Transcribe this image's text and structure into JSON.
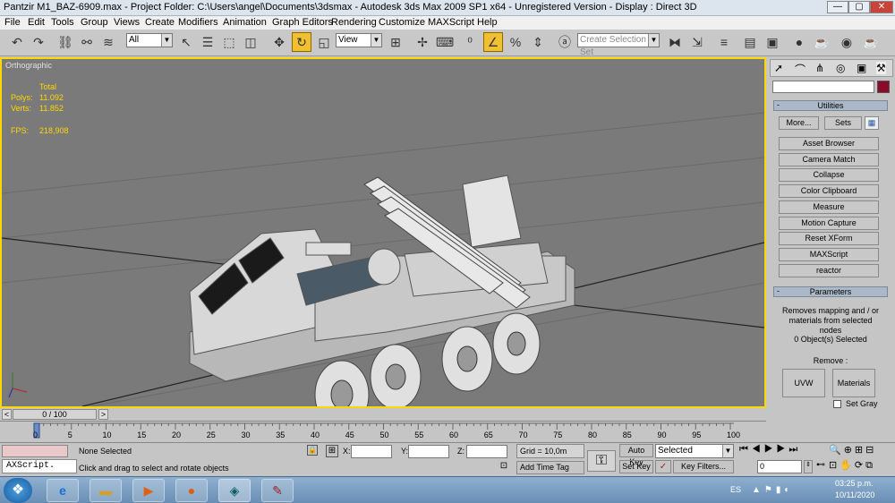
{
  "window": {
    "title": "Pantzir M1_BAZ-6909.max    - Project Folder: C:\\Users\\angel\\Documents\\3dsmax    - Autodesk 3ds Max  2009 SP1  x64   - Unregistered Version    - Display : Direct 3D",
    "minimize": "—",
    "maximize": "▢",
    "close": "✕"
  },
  "menubar": {
    "items": [
      "File",
      "Edit",
      "Tools",
      "Group",
      "Views",
      "Create",
      "Modifiers",
      "Animation",
      "Graph Editors",
      "Rendering",
      "Customize",
      "MAXScript",
      "Help"
    ]
  },
  "toolbar": {
    "filter_select": "All",
    "view_select": "View",
    "selection_set": "Create Selection Set"
  },
  "viewport": {
    "label": "Orthographic",
    "stats_header": "Total",
    "polys_label": "Polys:",
    "polys_value": "11.092",
    "verts_label": "Verts:",
    "verts_value": "11.852",
    "fps_label": "FPS:",
    "fps_value": "218,908",
    "bg_color": "#7a7a7a",
    "border_color": "#ffd700",
    "stats_color": "#ffd700"
  },
  "command_panel": {
    "name_field": "",
    "utilities_header": "Utilities",
    "more_button": "More...",
    "sets_button": "Sets",
    "utility_buttons": [
      "Asset Browser",
      "Camera Match",
      "Collapse",
      "Color Clipboard",
      "Measure",
      "Motion Capture",
      "Reset XForm",
      "MAXScript",
      "reactor"
    ],
    "parameters_header": "Parameters",
    "description": "Removes mapping and / or materials from selected nodes",
    "selected_count": "0 Object(s) Selected",
    "remove_label": "Remove :",
    "uvw_button": "UVW",
    "materials_button": "Materials",
    "set_gray_label": "Set Gray",
    "set_gray_checked": false,
    "swatch_color": "#8b0a2a"
  },
  "timeline": {
    "frame_display": "0 / 100",
    "prev_arrow": "<",
    "next_arrow": ">",
    "ticks": [
      "0",
      "5",
      "10",
      "15",
      "20",
      "25",
      "30",
      "35",
      "40",
      "45",
      "50",
      "55",
      "60",
      "65",
      "70",
      "75",
      "80",
      "85",
      "90",
      "95",
      "100"
    ]
  },
  "status": {
    "script_box": "AXScript.",
    "selection_status": "None Selected",
    "prompt": "Click and drag to select and rotate objects",
    "x_label": "X:",
    "y_label": "Y:",
    "z_label": "Z:",
    "x_value": "",
    "y_value": "",
    "z_value": "",
    "grid": "Grid = 10,0m",
    "add_time_tag": "Add Time Tag",
    "auto_key": "Auto Key",
    "set_key": "Set Key",
    "key_mode": "Selected",
    "key_filters": "Key Filters...",
    "current_frame": "0"
  },
  "taskbar": {
    "language": "ES",
    "time": "03:25 p.m.",
    "date": "10/11/2020"
  }
}
